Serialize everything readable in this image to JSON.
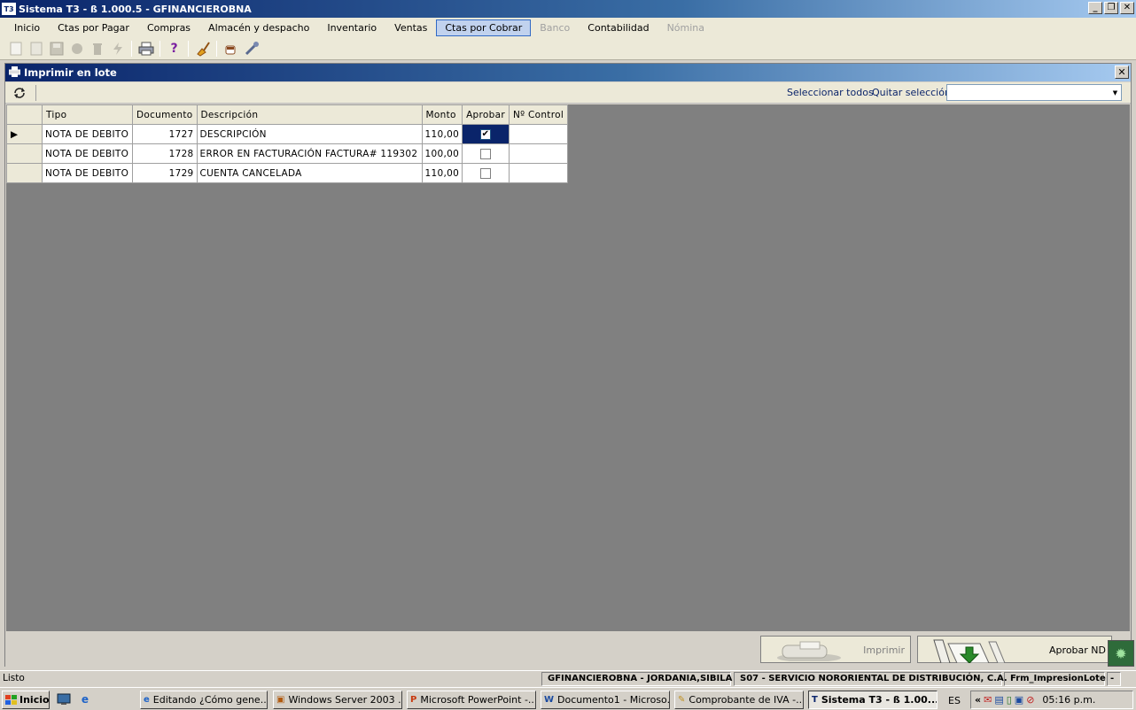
{
  "window": {
    "icon_text": "T3",
    "title": "Sistema T3 - ß 1.000.5 - GFINANCIEROBNA",
    "minimize": "_",
    "restore": "❐",
    "close": "✕"
  },
  "menu": [
    {
      "label": "Inicio",
      "state": "normal"
    },
    {
      "label": "Ctas por Pagar",
      "state": "normal"
    },
    {
      "label": "Compras",
      "state": "normal"
    },
    {
      "label": "Almacén y despacho",
      "state": "normal"
    },
    {
      "label": "Inventario",
      "state": "normal"
    },
    {
      "label": "Ventas",
      "state": "normal"
    },
    {
      "label": "Ctas por Cobrar",
      "state": "active"
    },
    {
      "label": "Banco",
      "state": "disabled"
    },
    {
      "label": "Contabilidad",
      "state": "normal"
    },
    {
      "label": "Nómina",
      "state": "disabled"
    }
  ],
  "child_window": {
    "title": "Imprimir en lote",
    "close": "✕",
    "select_all": "Seleccionar todos",
    "clear_selection": "Quitar selección",
    "filter_value": ""
  },
  "grid": {
    "columns": [
      "Tipo",
      "Documento",
      "Descripción",
      "Monto",
      "Aprobar",
      "Nº Control"
    ],
    "rows": [
      {
        "tipo": "NOTA DE DEBITO",
        "documento": "1727",
        "descripcion": "DESCRIPCIÓN",
        "monto": "110,00",
        "aprobar": true,
        "control": "",
        "current": true
      },
      {
        "tipo": "NOTA DE DEBITO",
        "documento": "1728",
        "descripcion": "ERROR EN FACTURACIÓN FACTURA# 119302",
        "monto": "100,00",
        "aprobar": false,
        "control": "",
        "current": false
      },
      {
        "tipo": "NOTA DE DEBITO",
        "documento": "1729",
        "descripcion": "CUENTA CANCELADA",
        "monto": "110,00",
        "aprobar": false,
        "control": "",
        "current": false
      }
    ]
  },
  "buttons": {
    "print": "Imprimir",
    "approve": "Aprobar ND"
  },
  "status": {
    "left": "Listo",
    "company_user": "GFINANCIEROBNA - JORDANIA,SIBILA",
    "branch": "S07 - SERVICIO NORORIENTAL DE DISTRIBUCIÓN, C.A.",
    "form": "Frm_ImpresionLote",
    "extra": "-"
  },
  "taskbar": {
    "start": "Inicio",
    "tasks": [
      {
        "label": "Editando ¿Cómo gene..."
      },
      {
        "label": "Windows Server 2003 ..."
      },
      {
        "label": "Microsoft PowerPoint -..."
      },
      {
        "label": "Documento1 - Microso..."
      },
      {
        "label": "Comprobante de IVA -..."
      },
      {
        "label": "Sistema T3 - ß 1.00..."
      }
    ],
    "lang": "ES",
    "clock": "05:16 p.m."
  }
}
